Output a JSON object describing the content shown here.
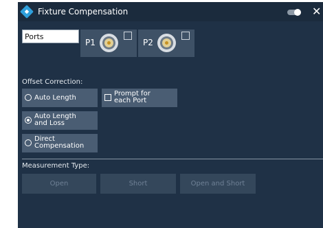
{
  "window": {
    "title": "Fixture Compensation"
  },
  "ports": {
    "selector_value": "Ports",
    "items": [
      {
        "label": "P1",
        "checked": false
      },
      {
        "label": "P2",
        "checked": false
      }
    ]
  },
  "offset_correction": {
    "label": "Offset Correction:",
    "options": [
      {
        "label": "Auto Length",
        "selected": false
      },
      {
        "label_line1": "Auto Length",
        "label_line2": "and Loss",
        "selected": true
      },
      {
        "label_line1": "Direct",
        "label_line2": "Compensation",
        "selected": false
      }
    ],
    "prompt": {
      "label_line1": "Prompt for",
      "label_line2": "each Port",
      "checked": false
    }
  },
  "measurement_type": {
    "label": "Measurement Type:",
    "buttons": [
      "Open",
      "Short",
      "Open and Short"
    ]
  },
  "colors": {
    "dialog_bg": "#1f3146",
    "button_bg": "#4a5d73",
    "disabled_button_bg": "#34475b",
    "accent": "#2fa0dc"
  },
  "icons": {
    "logo": "app-logo-icon",
    "toggle": "toggle-icon",
    "close": "close-icon",
    "connector": "connector-icon"
  }
}
